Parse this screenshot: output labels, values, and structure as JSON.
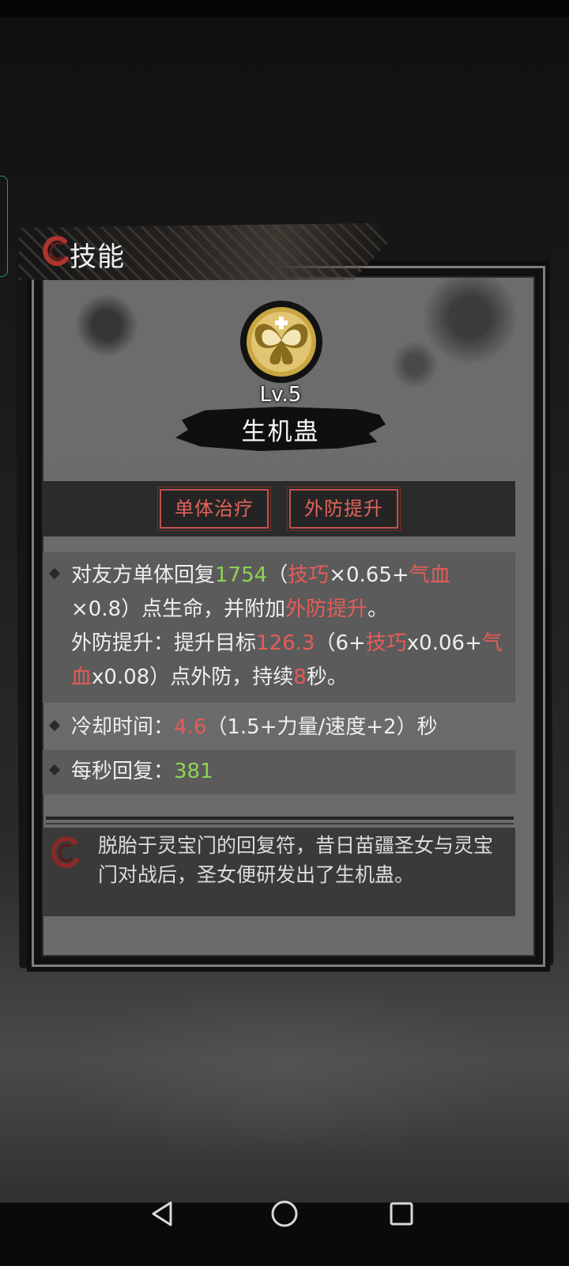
{
  "tab": {
    "title": "技能"
  },
  "skill": {
    "level": "Lv.5",
    "name": "生机蛊",
    "tags": [
      "单体治疗",
      "外防提升"
    ]
  },
  "description": {
    "effect": {
      "p1": "对友方单体回复",
      "heal": "1754",
      "p2": "（",
      "s1": "技巧",
      "p3": "×0.65+",
      "s2": "气血",
      "p4": "×0.8）点生命，并附加",
      "buff": "外防提升",
      "p5": "。",
      "p6": "外防提升：提升目标",
      "def": "126.3",
      "p7": "（6+",
      "s3": "技巧",
      "p8": "x0.06+",
      "s4": "气血",
      "p9": "x0.08）点外防，持续",
      "dur": "8",
      "p10": "秒。"
    },
    "cooldown": {
      "label": "冷却时间：",
      "value": "4.6",
      "formula": "（1.5+力量/速度+2）秒"
    },
    "regen": {
      "label": "每秒回复：",
      "value": "381"
    }
  },
  "lore": "脱胎于灵宝门的回复符，昔日苗疆圣女与灵宝门对战后，圣女便研发出了生机蛊。",
  "colors": {
    "accent_red": "#e45c58",
    "accent_green": "#8fd356",
    "tag_border": "#c0514b"
  },
  "icons": {
    "tab": "red-ring-icon",
    "skill": "golden-butterfly-emblem-icon",
    "lore": "red-ring-icon",
    "nav": [
      "back-triangle-icon",
      "home-circle-icon",
      "recent-square-icon"
    ]
  }
}
